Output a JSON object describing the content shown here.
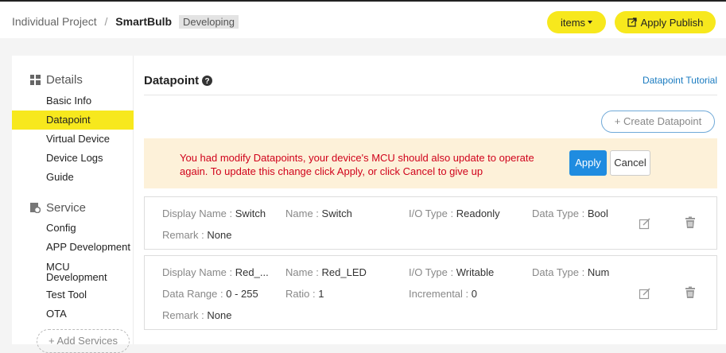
{
  "breadcrumb": {
    "parent": "Individual Project",
    "separator": "/",
    "project": "SmartBulb",
    "status": "Developing"
  },
  "header": {
    "items_label": "items",
    "publish_label": "Apply Publish"
  },
  "sidebar": {
    "details_title": "Details",
    "details_items": [
      {
        "label": "Basic Info"
      },
      {
        "label": "Datapoint",
        "active": true
      },
      {
        "label": "Virtual Device"
      },
      {
        "label": "Device Logs"
      },
      {
        "label": "Guide"
      }
    ],
    "service_title": "Service",
    "service_items": [
      {
        "label": "Config"
      },
      {
        "label": "APP Development"
      },
      {
        "label": "MCU Development"
      },
      {
        "label": "Test Tool"
      },
      {
        "label": "OTA"
      }
    ],
    "add_services_label": "+ Add Services"
  },
  "main": {
    "title": "Datapoint",
    "tutorial_link": "Datapoint Tutorial",
    "create_button": "+ Create Datapoint",
    "notice": {
      "text": "You had modify Datapoints, your device's MCU should also update to operate again. To update this change click Apply, or click Cancel to give up",
      "apply_label": "Apply",
      "cancel_label": "Cancel"
    },
    "datapoints": [
      {
        "display_name_label": "Display Name :",
        "display_name": "Switch",
        "name_label": "Name :",
        "name": "Switch",
        "io_label": "I/O Type :",
        "io_type": "Readonly",
        "type_label": "Data Type :",
        "data_type": "Bool",
        "remark_label": "Remark :",
        "remark": "None"
      },
      {
        "display_name_label": "Display Name :",
        "display_name": "Red_...",
        "name_label": "Name :",
        "name": "Red_LED",
        "io_label": "I/O Type :",
        "io_type": "Writable",
        "type_label": "Data Type :",
        "data_type": "Num",
        "range_label": "Data Range :",
        "data_range": "0 - 255",
        "ratio_label": "Ratio :",
        "ratio": "1",
        "incremental_label": "Incremental :",
        "incremental": "0",
        "remark_label": "Remark :",
        "remark": "None"
      }
    ]
  },
  "colors": {
    "accent_yellow": "#f7e81d",
    "link_blue": "#1a7bc0",
    "primary_blue": "#1f8ce0",
    "notice_bg": "#fdf1d9",
    "notice_text": "#d0021b"
  }
}
